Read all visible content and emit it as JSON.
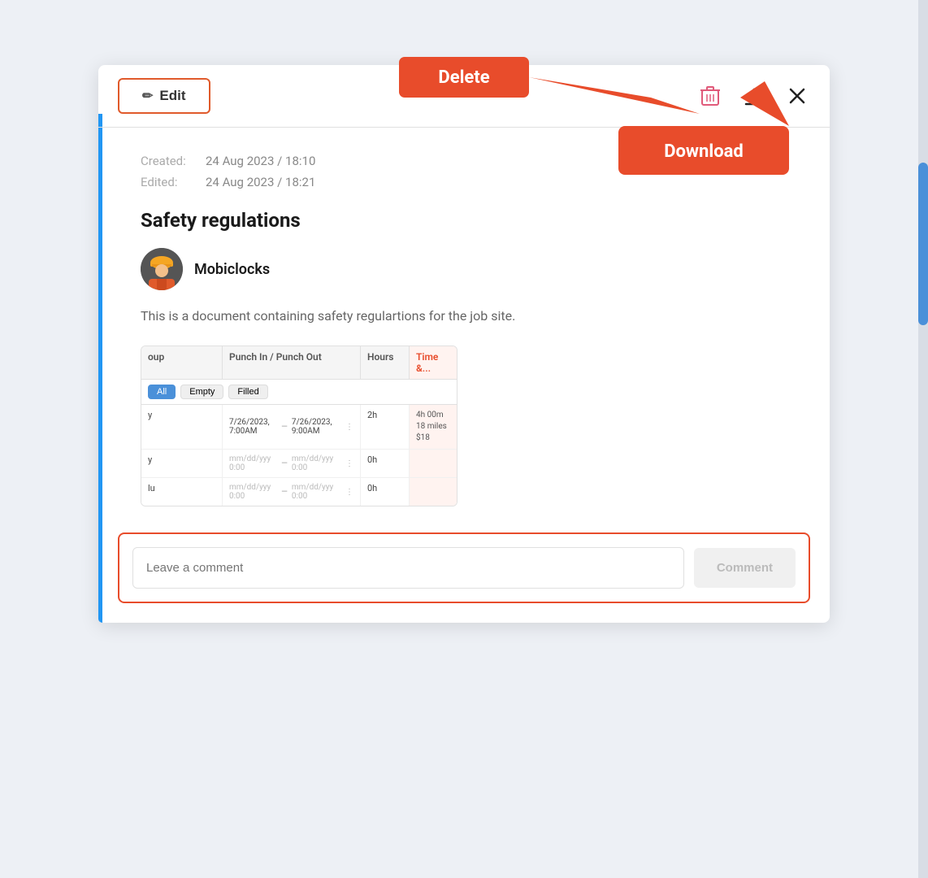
{
  "toolbar": {
    "edit_label": "Edit",
    "delete_callout": "Delete",
    "download_callout": "Download"
  },
  "meta": {
    "created_label": "Created:",
    "created_value": "24 Aug 2023 / 18:10",
    "edited_label": "Edited:",
    "edited_value": "24 Aug 2023 / 18:21"
  },
  "document": {
    "title": "Safety regulations",
    "author": "Mobiclocks",
    "description": "This is a document containing safety regulartions for the job site."
  },
  "preview_table": {
    "headers": [
      "oup",
      "Punch In / Punch Out",
      "Hours",
      "Time &..."
    ],
    "filters": [
      "All",
      "Empty",
      "Filled"
    ],
    "rows": [
      {
        "group": "y",
        "punch_in": "7/26/2023, 7:00AM",
        "punch_out": "7/26/2023, 9:00AM",
        "hours": "2h",
        "time_miles": "4h 00m\n18 miles\n$18"
      },
      {
        "group": "y",
        "punch_in": "mm/dd/yyy  0:00",
        "punch_out": "mm/dd/yyy  0:00",
        "hours": "0h",
        "time_miles": ""
      },
      {
        "group": "lu",
        "punch_in": "mm/dd/yyy  0:00",
        "punch_out": "mm/dd/yyy  0:00",
        "hours": "0h",
        "time_miles": ""
      }
    ]
  },
  "comment": {
    "placeholder": "Leave a comment",
    "button_label": "Comment"
  }
}
